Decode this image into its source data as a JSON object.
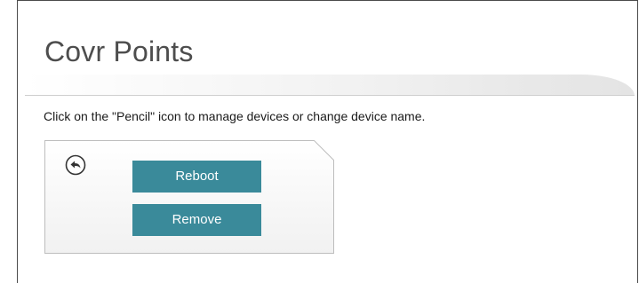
{
  "page": {
    "title": "Covr Points",
    "instruction": "Click on the \"Pencil\" icon to manage devices or change device name."
  },
  "device_card": {
    "back_icon": "back-arrow-icon",
    "buttons": {
      "reboot_label": "Reboot",
      "remove_label": "Remove"
    }
  },
  "colors": {
    "button_bg": "#3a8a9a",
    "button_text": "#ffffff",
    "title_text": "#4d4d4d"
  }
}
